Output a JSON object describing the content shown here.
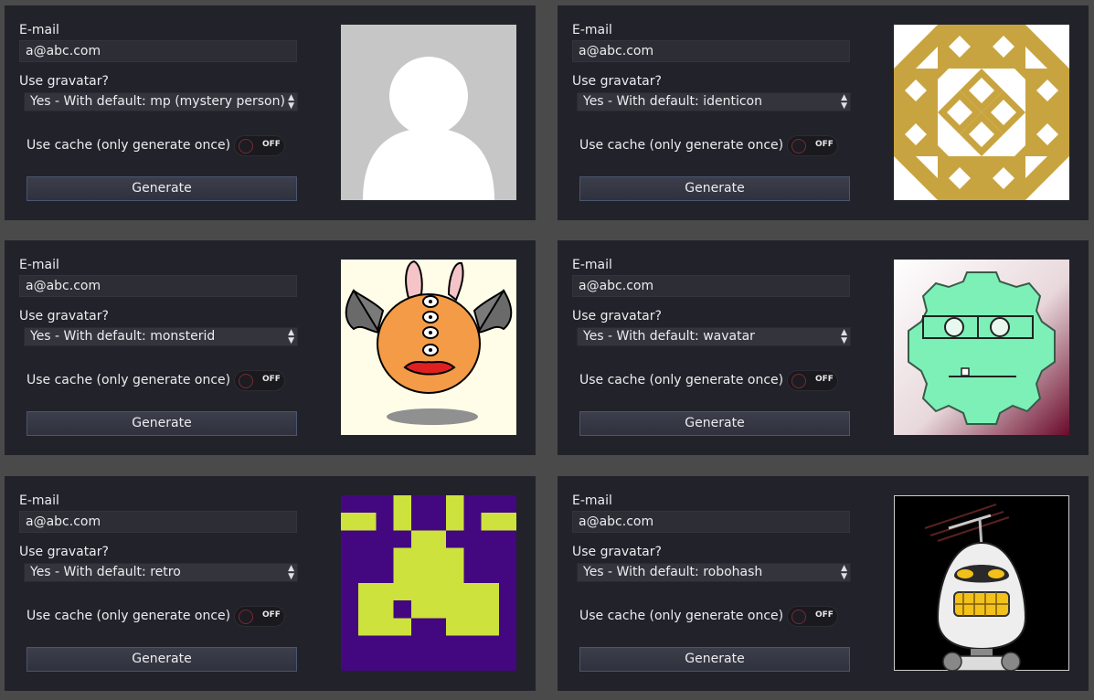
{
  "panels": [
    {
      "email_label": "E-mail",
      "email_value": "a@abc.com",
      "gravatar_label": "Use gravatar?",
      "gravatar_option": "Yes - With default: mp (mystery person)",
      "cache_label": "Use cache (only generate once)",
      "toggle_state": "OFF",
      "generate_label": "Generate",
      "avatar_style": "mp"
    },
    {
      "email_label": "E-mail",
      "email_value": "a@abc.com",
      "gravatar_label": "Use gravatar?",
      "gravatar_option": "Yes - With default: identicon",
      "cache_label": "Use cache (only generate once)",
      "toggle_state": "OFF",
      "generate_label": "Generate",
      "avatar_style": "identicon"
    },
    {
      "email_label": "E-mail",
      "email_value": "a@abc.com",
      "gravatar_label": "Use gravatar?",
      "gravatar_option": "Yes - With default: monsterid",
      "cache_label": "Use cache (only generate once)",
      "toggle_state": "OFF",
      "generate_label": "Generate",
      "avatar_style": "monsterid"
    },
    {
      "email_label": "E-mail",
      "email_value": "a@abc.com",
      "gravatar_label": "Use gravatar?",
      "gravatar_option": "Yes - With default: wavatar",
      "cache_label": "Use cache (only generate once)",
      "toggle_state": "OFF",
      "generate_label": "Generate",
      "avatar_style": "wavatar"
    },
    {
      "email_label": "E-mail",
      "email_value": "a@abc.com",
      "gravatar_label": "Use gravatar?",
      "gravatar_option": "Yes - With default: retro",
      "cache_label": "Use cache (only generate once)",
      "toggle_state": "OFF",
      "generate_label": "Generate",
      "avatar_style": "retro"
    },
    {
      "email_label": "E-mail",
      "email_value": "a@abc.com",
      "gravatar_label": "Use gravatar?",
      "gravatar_option": "Yes - With default: robohash",
      "cache_label": "Use cache (only generate once)",
      "toggle_state": "OFF",
      "generate_label": "Generate",
      "avatar_style": "robohash"
    }
  ],
  "colors": {
    "panel_bg": "#22222a",
    "app_bg": "#4a4a4a",
    "identicon_gold": "#c8a440",
    "retro_purple": "#43087f",
    "retro_lime": "#cde23c",
    "wavatar_green": "#7cf0b6",
    "monster_orange": "#f39b47"
  }
}
